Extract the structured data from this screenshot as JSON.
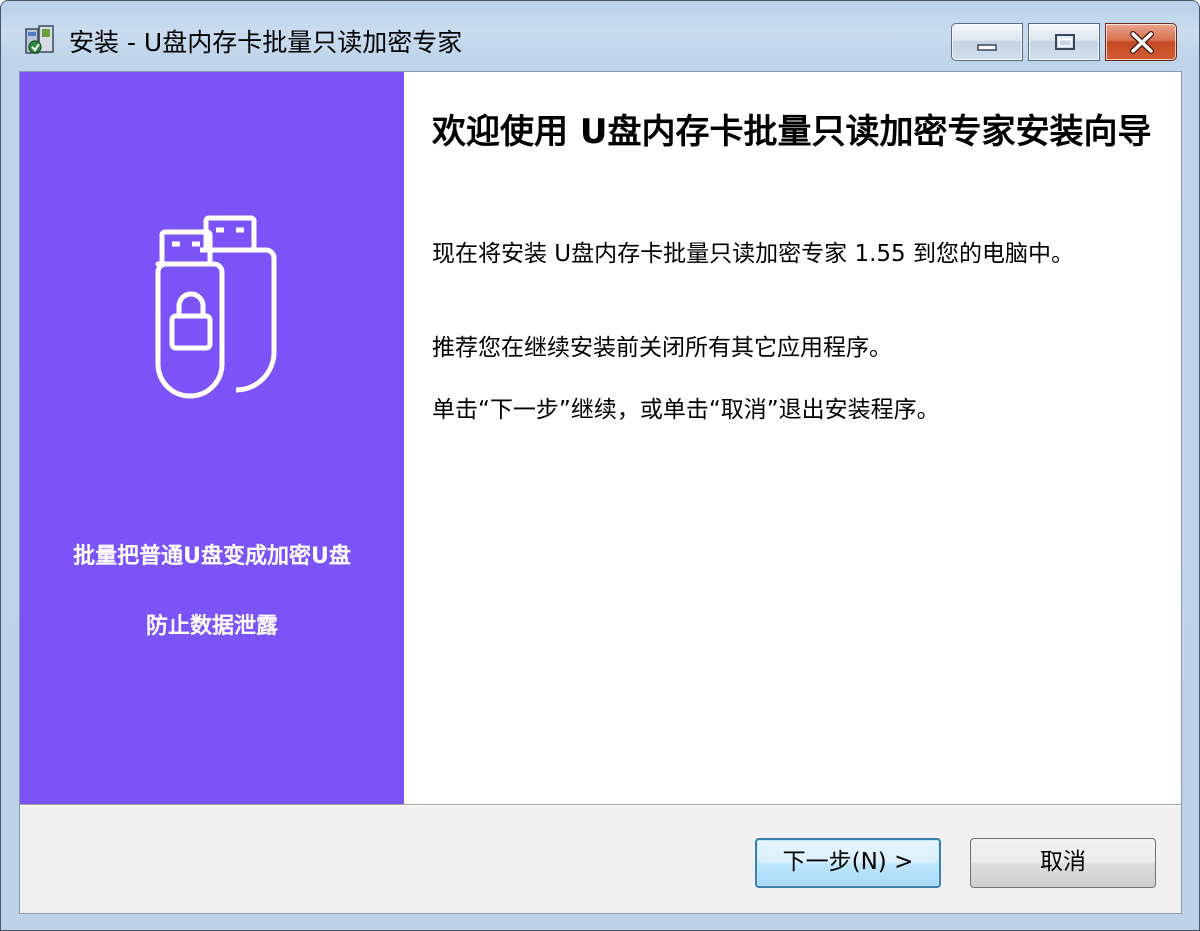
{
  "window": {
    "title": "安装 - U盘内存卡批量只读加密专家"
  },
  "side": {
    "line1": "批量把普通U盘变成加密U盘",
    "line2": "防止数据泄露",
    "bg_color": "#7c53f7"
  },
  "content": {
    "heading": "欢迎使用 U盘内存卡批量只读加密专家安装向导",
    "para1": "现在将安装 U盘内存卡批量只读加密专家 1.55 到您的电脑中。",
    "para2": "推荐您在继续安装前关闭所有其它应用程序。",
    "para3": "单击“下一步”继续，或单击“取消”退出安装程序。"
  },
  "buttons": {
    "next": "下一步(N) >",
    "cancel": "取消"
  },
  "icons": {
    "app": "installer-icon",
    "minimize": "minimize-icon",
    "maximize": "maximize-icon",
    "close": "close-icon",
    "usb": "usb-lock-icon"
  }
}
